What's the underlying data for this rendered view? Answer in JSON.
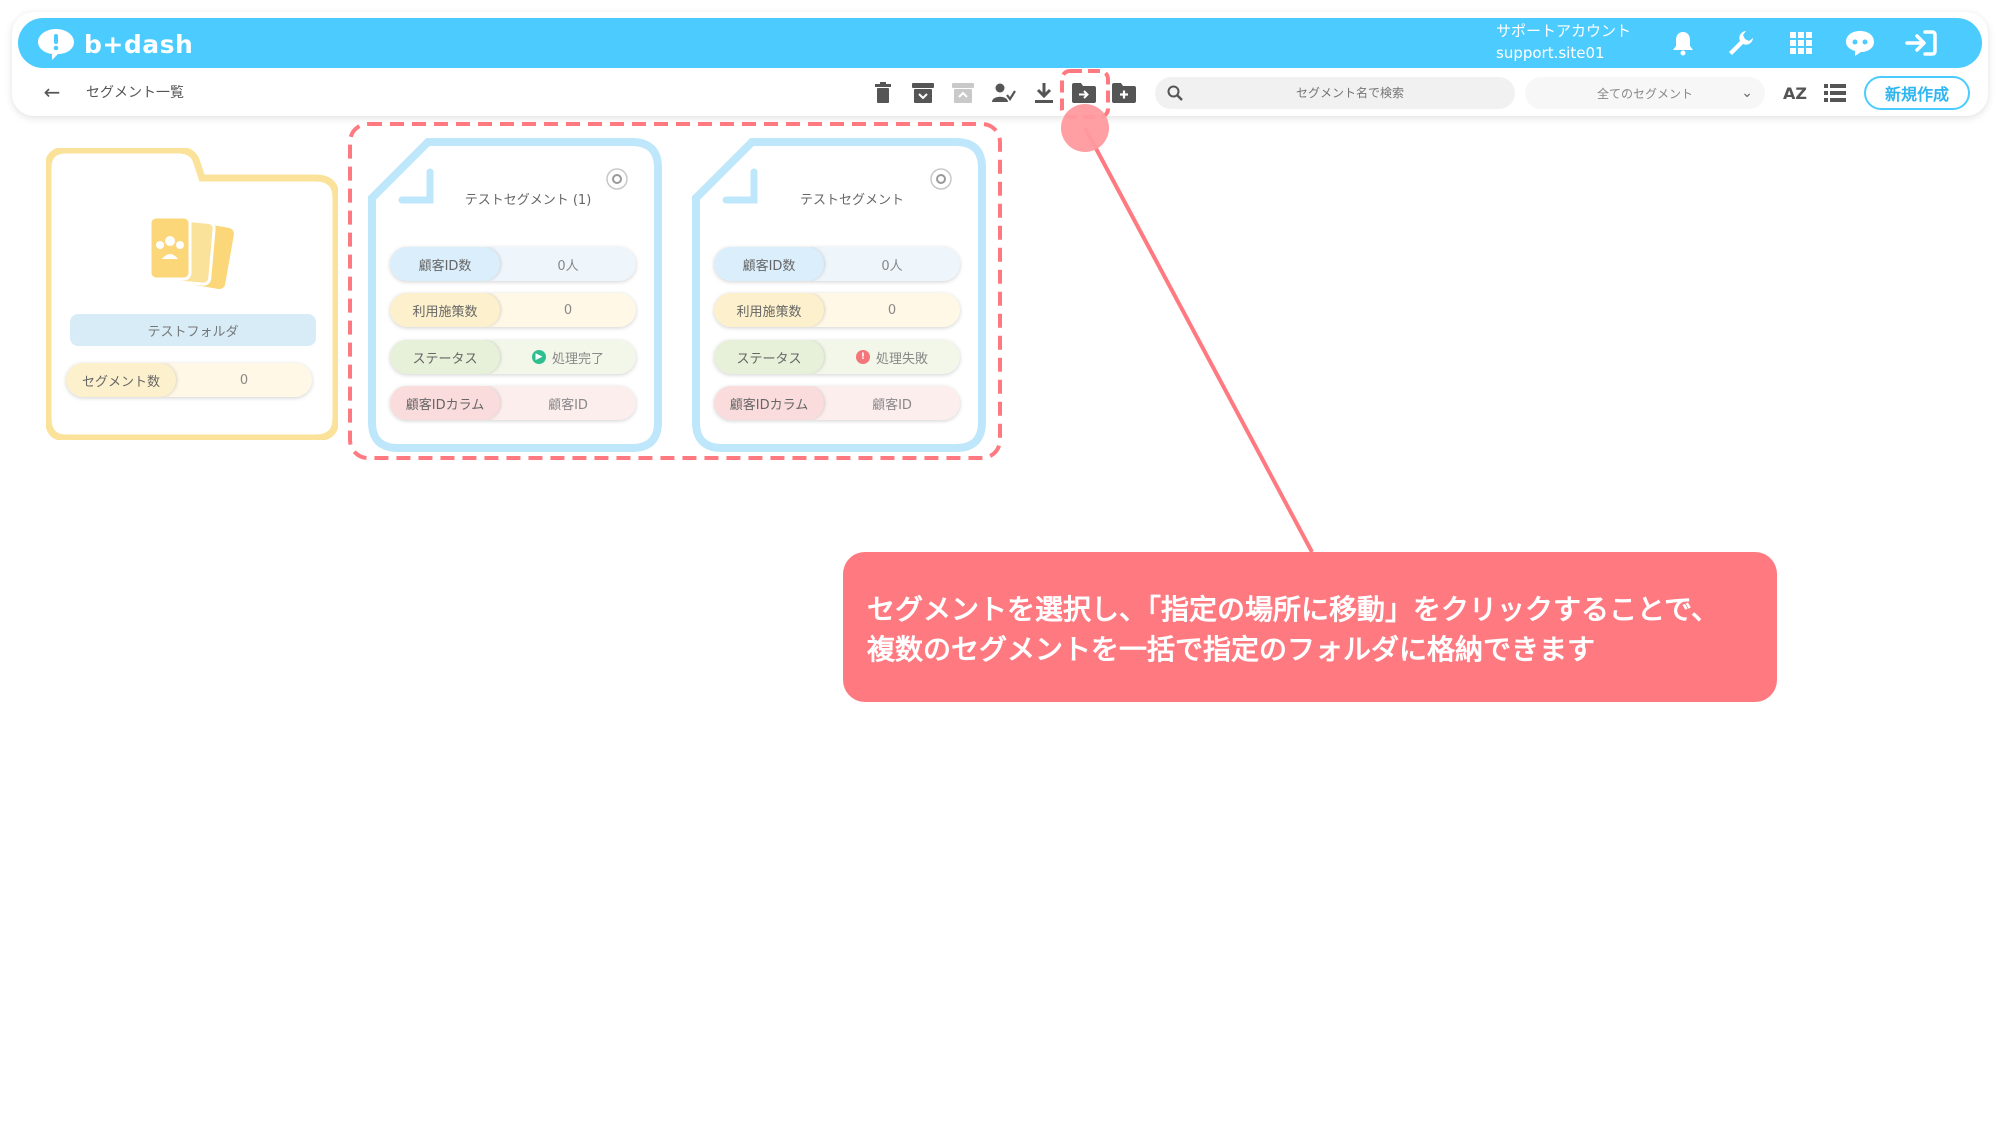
{
  "header": {
    "logo_text": "b+dash",
    "account_name": "サポートアカウント",
    "account_id": "support.site01",
    "icons": [
      "bell-icon",
      "wrench-icon",
      "apps-grid-icon",
      "chat-bot-icon",
      "logout-icon"
    ]
  },
  "toolbar": {
    "page_title": "セグメント一覧",
    "tools": [
      "trash-icon",
      "archive-icon",
      "restore-icon",
      "user-check-icon",
      "download-icon",
      "move-to-folder-icon",
      "new-folder-icon"
    ],
    "search_placeholder": "セグメント名で検索",
    "filter_selected": "全てのセグメント",
    "sort_label": "AZ",
    "new_button": "新規作成"
  },
  "folder": {
    "name": "テストフォルダ",
    "count_label": "セグメント数",
    "count_value": "0"
  },
  "segments": [
    {
      "title": "テストセグメント (1)",
      "rows": [
        {
          "key": "顧客ID数",
          "value": "0人"
        },
        {
          "key": "利用施策数",
          "value": "0"
        },
        {
          "key": "ステータス",
          "value": "処理完了"
        },
        {
          "key": "顧客IDカラム",
          "value": "顧客ID"
        }
      ],
      "status": "success"
    },
    {
      "title": "テストセグメント",
      "rows": [
        {
          "key": "顧客ID数",
          "value": "0人"
        },
        {
          "key": "利用施策数",
          "value": "0"
        },
        {
          "key": "ステータス",
          "value": "処理失敗"
        },
        {
          "key": "顧客IDカラム",
          "value": "顧客ID"
        }
      ],
      "status": "error"
    }
  ],
  "callout": {
    "line1": "セグメントを選択し、「指定の場所に移動」をクリックすることで、",
    "line2": "複数のセグメントを一括で指定のフォルダに格納できます"
  },
  "colors": {
    "brand": "#4ccbff",
    "folder": "#fbe29a",
    "segment_border": "#bfe7fb",
    "annotation": "#ff7a80",
    "status_success": "#2fbf8f",
    "status_error": "#f4767b"
  }
}
